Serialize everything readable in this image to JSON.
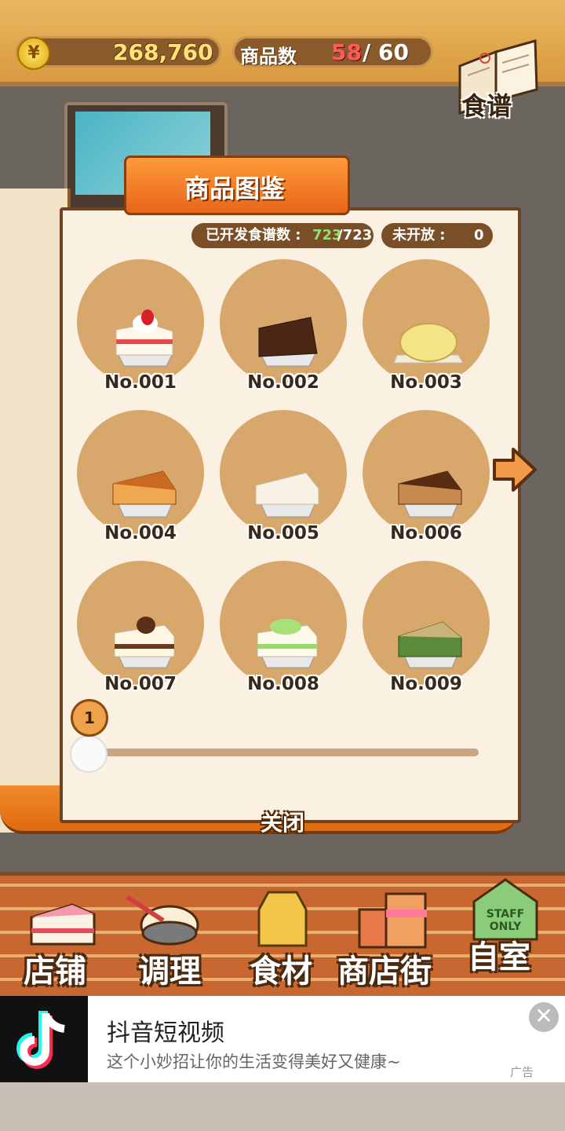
{
  "top_bar": {
    "currency_symbol": "¥",
    "coins": "268,760",
    "goods_label": "商品数",
    "goods_count": "58",
    "goods_max": "/ 60"
  },
  "recipe_button": {
    "label": "食谱"
  },
  "catalog": {
    "title": "商品图鉴",
    "unlocked_label": "已开发食谱数 :",
    "unlocked_value": "723",
    "unlocked_total": "/723",
    "closed_label": "未开放 :",
    "closed_value": "0",
    "items": [
      {
        "number": "No.001",
        "icon": "strawberry-shortcake-icon"
      },
      {
        "number": "No.002",
        "icon": "chocolate-cake-icon"
      },
      {
        "number": "No.003",
        "icon": "melon-bread-icon"
      },
      {
        "number": "No.004",
        "icon": "cheesecake-icon"
      },
      {
        "number": "No.005",
        "icon": "rare-cheesecake-icon"
      },
      {
        "number": "No.006",
        "icon": "baked-cheesecake-icon"
      },
      {
        "number": "No.007",
        "icon": "chestnut-cake-icon"
      },
      {
        "number": "No.008",
        "icon": "melon-shortcake-icon"
      },
      {
        "number": "No.009",
        "icon": "matcha-cake-icon"
      }
    ],
    "page_indicator": "1",
    "page_progress": 0.0,
    "close_label": "关闭"
  },
  "nav": [
    {
      "label": "店铺",
      "icon": "shop-cake-icon"
    },
    {
      "label": "调理",
      "icon": "mixing-bowl-icon"
    },
    {
      "label": "食材",
      "icon": "ingredient-bag-icon"
    },
    {
      "label": "商店街",
      "icon": "shopping-street-icon"
    },
    {
      "label": "自室",
      "icon": "staff-only-door-icon"
    }
  ],
  "ad": {
    "title": "抖音短视频",
    "description": "这个小妙招让你的生活变得美好又健康~",
    "tag": "广告",
    "close_symbol": "✕"
  },
  "colors": {
    "accent": "#e8661a",
    "cell": "#d8a76c",
    "unlocked": "#8fe070",
    "goods_count": "#ff5a5a"
  }
}
